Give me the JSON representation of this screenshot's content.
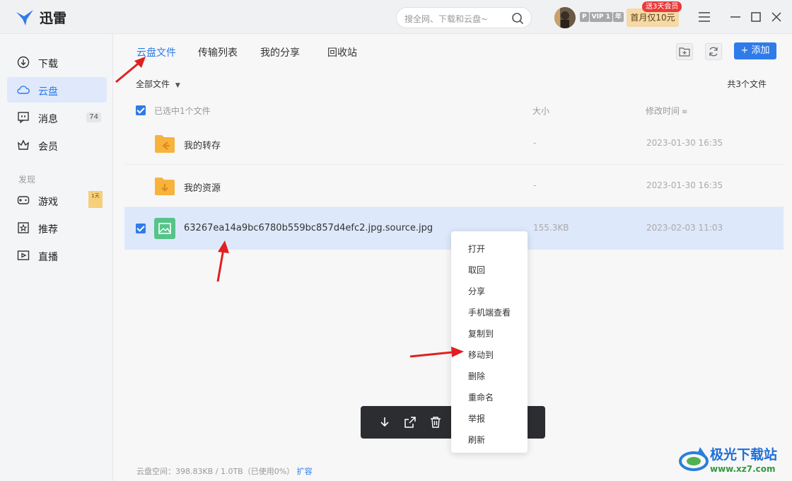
{
  "app": {
    "name": "迅雷"
  },
  "search": {
    "placeholder": "搜全网、下载和云盘~"
  },
  "account": {
    "vip_label": "VIP 1",
    "vip_suffix": "年",
    "promo_label": "首月仅10元",
    "promo_badge": "送3天会员"
  },
  "sidebar": {
    "items": [
      {
        "label": "下载",
        "icon": "download-icon"
      },
      {
        "label": "云盘",
        "icon": "cloud-icon",
        "active": true
      },
      {
        "label": "消息",
        "icon": "message-icon",
        "count": "74"
      },
      {
        "label": "会员",
        "icon": "crown-icon"
      }
    ],
    "section": "发现",
    "discover": [
      {
        "label": "游戏",
        "icon": "gamepad-icon",
        "badge": "1天"
      },
      {
        "label": "推荐",
        "icon": "star-icon"
      },
      {
        "label": "直播",
        "icon": "live-icon"
      }
    ]
  },
  "tabs": [
    "云盘文件",
    "传输列表",
    "我的分享",
    "回收站"
  ],
  "toolbar": {
    "add_label": "添加"
  },
  "filter": {
    "label": "全部文件"
  },
  "total": "共3个文件",
  "header": {
    "selected": "已选中1个文件",
    "size": "大小",
    "time": "修改时间"
  },
  "files": [
    {
      "name": "我的转存",
      "size": "-",
      "time": "2023-01-30 16:35",
      "type": "folder-transfer"
    },
    {
      "name": "我的资源",
      "size": "-",
      "time": "2023-01-30 16:35",
      "type": "folder-resource"
    },
    {
      "name": "63267ea14a9bc6780b559bc857d4efc2.jpg.source.jpg",
      "size": "155.3KB",
      "time": "2023-02-03 11:03",
      "type": "image",
      "selected": true
    }
  ],
  "context_menu": [
    "打开",
    "取回",
    "分享",
    "手机端查看",
    "复制到",
    "移动到",
    "删除",
    "重命名",
    "举报",
    "刷新"
  ],
  "footer": {
    "storage": "云盘空间：398.83KB / 1.0TB（已使用0%）",
    "expand": "扩容"
  },
  "watermark": {
    "title": "极光下载站",
    "url": "www.xz7.com"
  },
  "colors": {
    "accent": "#2f7be9",
    "annotation": "#e02020"
  }
}
